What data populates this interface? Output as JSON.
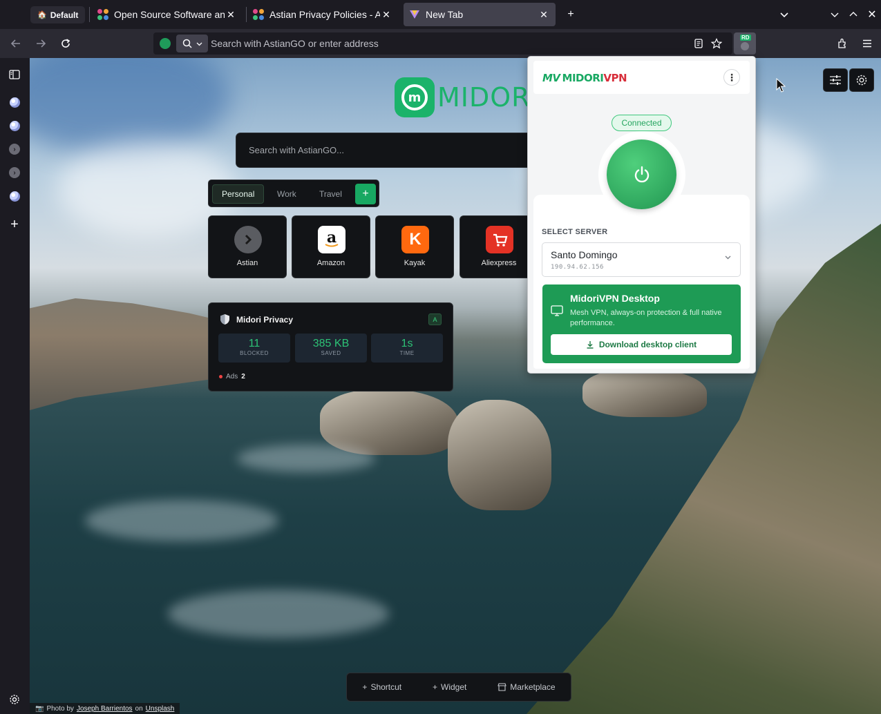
{
  "browser": {
    "profile_label": "Default",
    "tabs": [
      {
        "title": "Open Source Software and"
      },
      {
        "title": "Astian Privacy Policies - Ast"
      },
      {
        "title": "New Tab"
      }
    ],
    "address_placeholder": "Search with AstianGO or enter address",
    "extension_badge": "RD"
  },
  "newtab": {
    "brand": "MIDORI",
    "brand_mark_letter": "m",
    "search_placeholder": "Search with AstianGO...",
    "groups": [
      "Personal",
      "Work",
      "Travel"
    ],
    "add_group_label": "+",
    "shortcuts": [
      {
        "label": "Astian",
        "icon": "chevron-right-icon"
      },
      {
        "label": "Amazon",
        "icon": "amazon-icon"
      },
      {
        "label": "Kayak",
        "icon": "kayak-icon",
        "letter": "K"
      },
      {
        "label": "Aliexpress",
        "icon": "cart-icon"
      }
    ],
    "privacy": {
      "title": "Midori Privacy",
      "grade": "A",
      "stats": [
        {
          "value": "11",
          "label": "BLOCKED"
        },
        {
          "value": "385 KB",
          "label": "SAVED"
        },
        {
          "value": "1s",
          "label": "TIME"
        }
      ],
      "ads_label": "Ads",
      "ads_count": "2"
    },
    "bottom_actions": [
      {
        "label": "Shortcut",
        "icon": "plus-icon"
      },
      {
        "label": "Widget",
        "icon": "plus-icon"
      },
      {
        "label": "Marketplace",
        "icon": "store-icon"
      }
    ],
    "credit": {
      "prefix": "Photo by",
      "author": "Joseph Barrientos",
      "on": "on",
      "site": "Unsplash"
    }
  },
  "vpn": {
    "logo_mark": "MV",
    "logo_a": "MIDORI",
    "logo_b": "VPN",
    "status": "Connected",
    "select_label": "SELECT SERVER",
    "server_city": "Santo Domingo",
    "server_ip": "190.94.62.156",
    "promo_title": "MidoriVPN Desktop",
    "promo_desc": "Mesh VPN, always-on protection & full native performance.",
    "download_label": "Download desktop client",
    "colors": {
      "accent": "#18a862",
      "brand_red": "#d72e3a"
    }
  }
}
